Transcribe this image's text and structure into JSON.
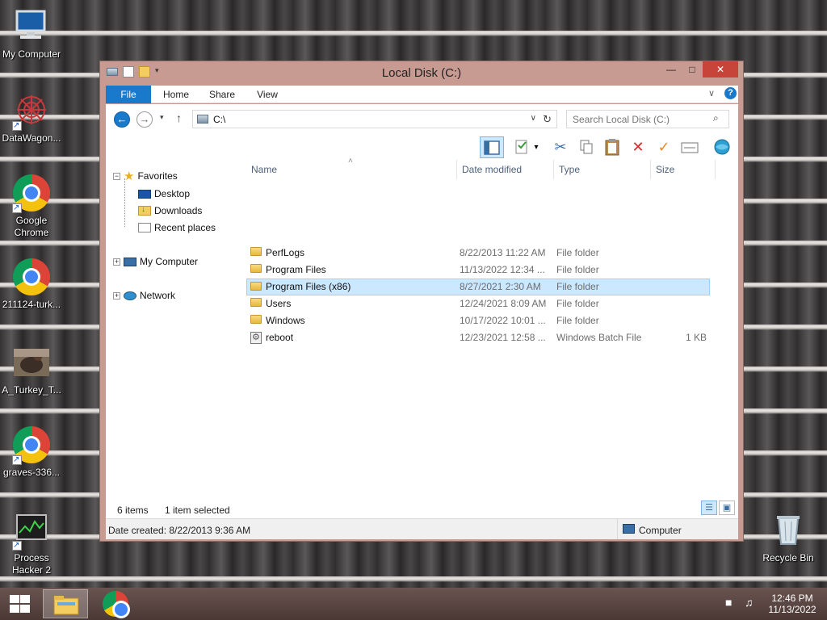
{
  "desktop": {
    "icons": [
      {
        "label": "My Computer"
      },
      {
        "label": "DataWagon..."
      },
      {
        "label": "Google Chrome",
        "line1": "Google",
        "line2": "Chrome"
      },
      {
        "label": "211124-turk..."
      },
      {
        "label": "A_Turkey_T..."
      },
      {
        "label": "graves-336..."
      },
      {
        "label": "Process Hacker 2",
        "line1": "Process",
        "line2": "Hacker 2"
      },
      {
        "label": "Recycle Bin"
      }
    ]
  },
  "window": {
    "title": "Local Disk (C:)",
    "controls": {
      "minimize": "—",
      "maximize": "□",
      "close": "✕"
    },
    "ribbon_tabs": [
      "File",
      "Home",
      "Share",
      "View"
    ],
    "ribbon_expand": "∨",
    "help": "?",
    "address": {
      "path": "C:\\",
      "dropdown": "∨",
      "refresh": "↻"
    },
    "nav": {
      "back": "←",
      "forward": "→",
      "recent": "▾",
      "up": "↑"
    },
    "search_placeholder": "Search Local Disk (C:)",
    "search_icon": "⌕",
    "nav_pane": {
      "favorites_label": "Favorites",
      "favorites": [
        "Desktop",
        "Downloads",
        "Recent places"
      ],
      "computer_label": "My Computer",
      "network_label": "Network",
      "collapse": "−",
      "expand": "+"
    },
    "columns": {
      "name": "Name",
      "date": "Date modified",
      "type": "Type",
      "size": "Size",
      "sort_indicator": "˄"
    },
    "files": [
      {
        "name": "PerfLogs",
        "date": "8/22/2013 11:22 AM",
        "type": "File folder",
        "size": "",
        "icon": "folder-icon"
      },
      {
        "name": "Program Files",
        "date": "11/13/2022 12:34 ...",
        "type": "File folder",
        "size": "",
        "icon": "folder-icon"
      },
      {
        "name": "Program Files (x86)",
        "date": "8/27/2021 2:30 AM",
        "type": "File folder",
        "size": "",
        "icon": "folder-icon",
        "selected": true
      },
      {
        "name": "Users",
        "date": "12/24/2021 8:09 AM",
        "type": "File folder",
        "size": "",
        "icon": "folder-icon"
      },
      {
        "name": "Windows",
        "date": "10/17/2022 10:01 ...",
        "type": "File folder",
        "size": "",
        "icon": "folder-icon"
      },
      {
        "name": "reboot",
        "date": "12/23/2021 12:58 ...",
        "type": "Windows Batch File",
        "size": "1 KB",
        "icon": "batch-file-icon"
      }
    ],
    "status": {
      "items_count": "6 items",
      "selected_count": "1 item selected"
    },
    "details": {
      "date_created": "Date created: 8/22/2013 9:36 AM",
      "location": "Computer"
    }
  },
  "taskbar": {
    "clock_time": "12:46 PM",
    "clock_date": "11/13/2022"
  }
}
